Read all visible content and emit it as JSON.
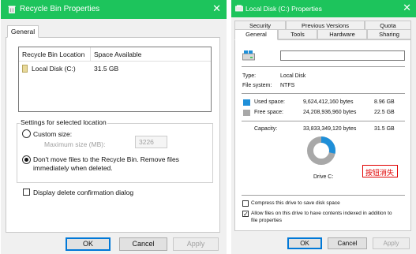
{
  "left_window": {
    "title": "Recycle Bin Properties",
    "close_glyph": "✕",
    "tab": "General",
    "table": {
      "headers": [
        "Recycle Bin Location",
        "Space Available"
      ],
      "rows": [
        {
          "location": "Local Disk (C:)",
          "space": "31.5 GB"
        }
      ]
    },
    "settings_group": "Settings for selected location",
    "custom_size_label": "Custom size:",
    "max_size_label": "Maximum size (MB):",
    "max_size_value": "3226",
    "dont_move_line1": "Don't move files to the Recycle Bin. Remove files",
    "dont_move_line2": "immediately when deleted.",
    "custom_size_checked": false,
    "dont_move_checked": true,
    "confirm_dialog_label": "Display delete confirmation dialog",
    "confirm_dialog_checked": false,
    "buttons": {
      "ok": "OK",
      "cancel": "Cancel",
      "apply": "Apply"
    }
  },
  "right_window": {
    "title": "Local Disk (C:) Properties",
    "close_glyph": "✕",
    "tabs_row1": [
      "Security",
      "Previous Versions",
      "Quota"
    ],
    "tabs_row2": [
      "General",
      "Tools",
      "Hardware",
      "Sharing"
    ],
    "active_tab": "General",
    "type_label": "Type:",
    "type_value": "Local Disk",
    "fs_label": "File system:",
    "fs_value": "NTFS",
    "used_label": "Used space:",
    "used_bytes": "9,624,412,160 bytes",
    "used_gb": "8.96 GB",
    "free_label": "Free space:",
    "free_bytes": "24,208,936,960 bytes",
    "free_gb": "22.5 GB",
    "capacity_label": "Capacity:",
    "capacity_bytes": "33,833,349,120 bytes",
    "capacity_gb": "31.5 GB",
    "drive_label": "Drive C:",
    "annotation": "按钮消失",
    "compress_label": "Compress this drive to save disk space",
    "compress_checked": false,
    "index_line1": "Allow files on this drive to have contents indexed in addition to",
    "index_line2": "file properties",
    "index_checked": true,
    "used_fraction": 0.284,
    "buttons": {
      "ok": "OK",
      "cancel": "Cancel",
      "apply": "Apply"
    }
  },
  "colors": {
    "titlebar": "#1dc45c",
    "used_space": "#1f8fd8",
    "free_space": "#a8a8a8",
    "annotation": "#e00000",
    "default_button_border": "#0078d7"
  }
}
